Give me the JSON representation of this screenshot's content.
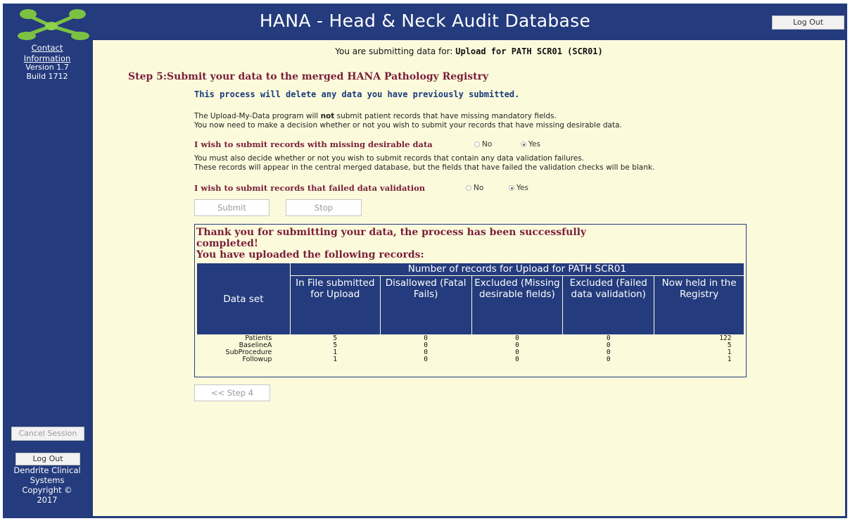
{
  "header": {
    "title": "HANA - Head & Neck Audit Database",
    "logout_label": "Log Out",
    "logo_icon": "molecule-logo-icon"
  },
  "sidebar": {
    "contact_line1": "Contact",
    "contact_line2": "Information",
    "version": "Version 1.7",
    "build": "Build 1712",
    "cancel_label": "Cancel Session",
    "logout_label": "Log Out",
    "copyright_lines": [
      "Dendrite Clinical",
      "Systems",
      "Copyright ©",
      "2017"
    ]
  },
  "main": {
    "submitting_prefix": "You are submitting data for: ",
    "submitting_target": "Upload for PATH SCR01 (SCR01)",
    "step_title": "Step 5:Submit your data to the merged HANA Pathology Registry",
    "warning": "This process will delete any data you have previously submitted.",
    "info1_a": "The Upload-My-Data program will ",
    "info1_bold": "not",
    "info1_b": " submit patient records that have missing mandatory fields.",
    "info1_line2": "You now need to make a decision whether or not you wish to submit your records that have missing desirable data.",
    "question1": "I wish to submit records with missing desirable data",
    "info2_line1": "You must also decide whether or not you wish to submit records that contain any data validation failures.",
    "info2_line2": "These records will appear in the central merged database, but the fields that have failed the validation checks will be blank.",
    "question2": "I wish to submit records that failed data validation",
    "radio_no": "No",
    "radio_yes": "Yes",
    "q1_selected": "Yes",
    "q2_selected": "Yes",
    "submit_label": "Submit",
    "stop_label": "Stop",
    "back_label": "<< Step 4"
  },
  "results": {
    "thanks_line1": "Thank you for submitting your data, the process has been successfully",
    "thanks_line2": "completed!",
    "thanks_line3": "You have uploaded the following records:",
    "group_header": "Number of records for Upload for PATH SCR01",
    "dataset_header": "Data set",
    "columns": [
      "In File submitted for Upload",
      "Disallowed (Fatal Fails)",
      "Excluded (Missing desirable fields)",
      "Excluded (Failed data validation)",
      "Now held in the Registry"
    ],
    "rows": [
      {
        "name": "Patients",
        "values": [
          "5",
          "0",
          "0",
          "0",
          "122"
        ]
      },
      {
        "name": "BaselineA",
        "values": [
          "5",
          "0",
          "0",
          "0",
          "5"
        ]
      },
      {
        "name": "SubProcedure",
        "values": [
          "1",
          "0",
          "0",
          "0",
          "1"
        ]
      },
      {
        "name": "Followup",
        "values": [
          "1",
          "0",
          "0",
          "0",
          "1"
        ]
      }
    ]
  },
  "colors": {
    "navy": "#243b7d",
    "panel": "#fbfbdc",
    "maroon": "#7a1e3a",
    "logo_green": "#7cc242"
  }
}
